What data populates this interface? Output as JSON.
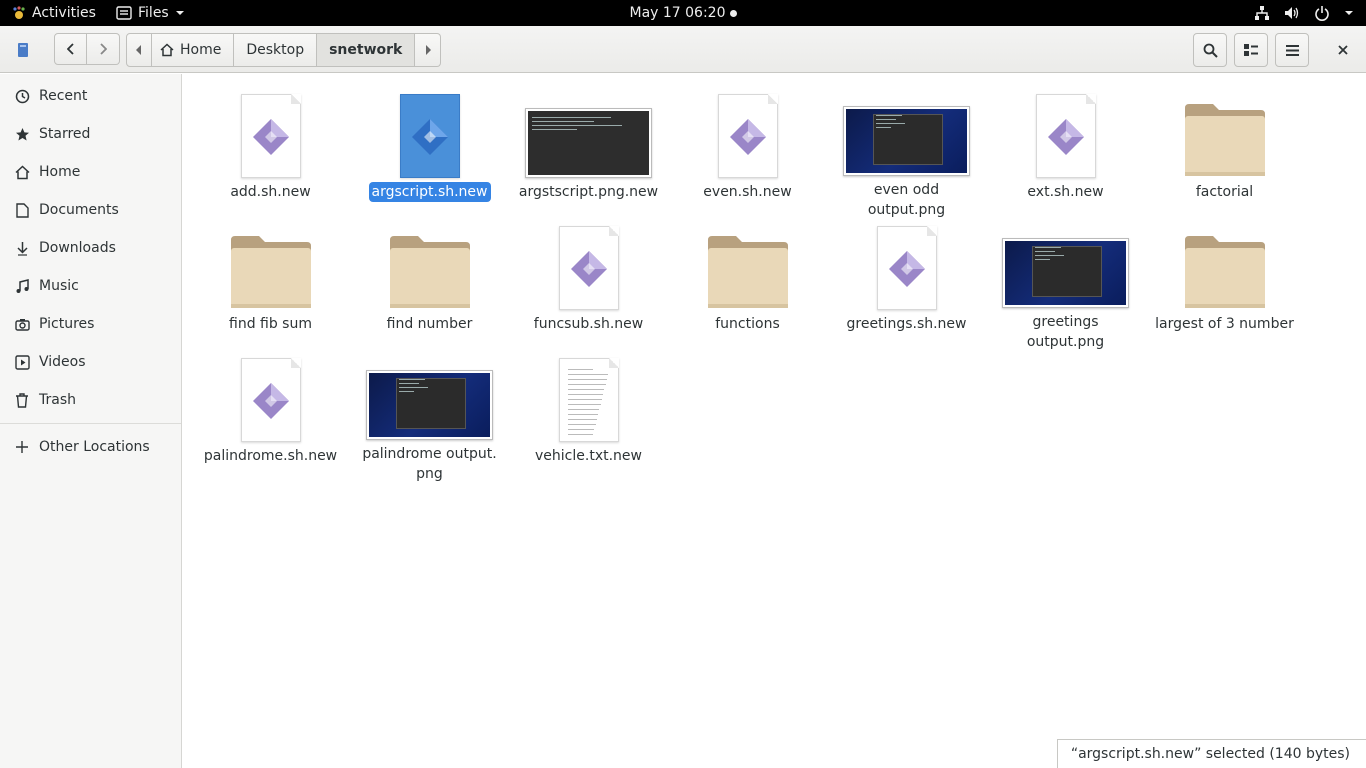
{
  "topbar": {
    "activities": "Activities",
    "app_name": "Files",
    "clock": "May 17  06:20"
  },
  "header": {
    "path": [
      "Home",
      "Desktop",
      "snetwork"
    ]
  },
  "sidebar": {
    "items": [
      {
        "label": "Recent",
        "icon": "clock-icon"
      },
      {
        "label": "Starred",
        "icon": "star-icon"
      },
      {
        "label": "Home",
        "icon": "home-icon"
      },
      {
        "label": "Documents",
        "icon": "document-icon"
      },
      {
        "label": "Downloads",
        "icon": "download-icon"
      },
      {
        "label": "Music",
        "icon": "music-icon"
      },
      {
        "label": "Pictures",
        "icon": "camera-icon"
      },
      {
        "label": "Videos",
        "icon": "video-icon"
      },
      {
        "label": "Trash",
        "icon": "trash-icon"
      }
    ],
    "other": "Other Locations"
  },
  "files": [
    {
      "name": "add.sh.new",
      "kind": "script"
    },
    {
      "name": "argscript.sh.new",
      "kind": "script",
      "selected": true
    },
    {
      "name": "argstscript.png.new",
      "kind": "image-dark"
    },
    {
      "name": "even.sh.new",
      "kind": "script"
    },
    {
      "name": "even odd output.png",
      "kind": "image"
    },
    {
      "name": "ext.sh.new",
      "kind": "script"
    },
    {
      "name": "factorial",
      "kind": "folder"
    },
    {
      "name": "find fib sum",
      "kind": "folder"
    },
    {
      "name": "find number",
      "kind": "folder"
    },
    {
      "name": "funcsub.sh.new",
      "kind": "script"
    },
    {
      "name": "functions",
      "kind": "folder"
    },
    {
      "name": "greetings.sh.new",
      "kind": "script"
    },
    {
      "name": "greetings output.png",
      "kind": "image"
    },
    {
      "name": "largest of 3 number",
      "kind": "folder"
    },
    {
      "name": "palindrome.sh.new",
      "kind": "script"
    },
    {
      "name": "palindrome output.\npng",
      "kind": "image"
    },
    {
      "name": "vehicle.txt.new",
      "kind": "text"
    }
  ],
  "status": "“argscript.sh.new” selected  (140 bytes)",
  "colors": {
    "accent": "#3584e4",
    "folder": "#e9d8b8"
  }
}
